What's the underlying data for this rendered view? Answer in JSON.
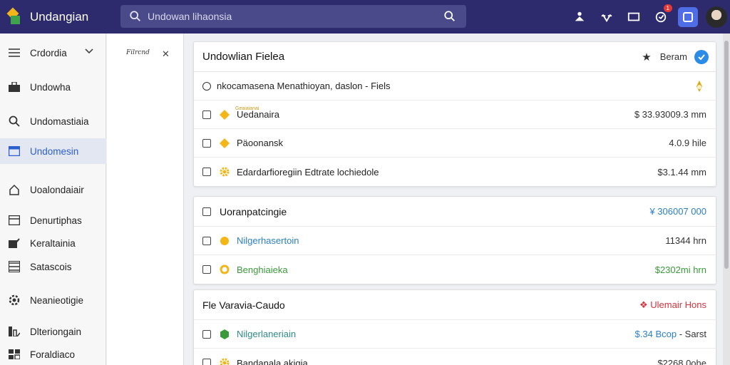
{
  "app": {
    "name": "Undangian"
  },
  "search": {
    "placeholder": "Undowan lihaonsia"
  },
  "topbar": {
    "notification_count": "1"
  },
  "sidebar": {
    "items": [
      {
        "label": "Crdordia",
        "icon": "menu-icon"
      },
      {
        "label": "Undowha",
        "icon": "briefcase-icon"
      },
      {
        "label": "Undomastiaia",
        "icon": "search-icon"
      },
      {
        "label": "Undomesin",
        "icon": "window-icon",
        "active": true
      },
      {
        "label": "Uoalondaiair",
        "icon": "home-icon"
      },
      {
        "label": "Denurtiphas",
        "icon": "window-icon"
      },
      {
        "label": "Keraltainia",
        "icon": "edit-icon"
      },
      {
        "label": "Satascois",
        "icon": "list-icon"
      },
      {
        "label": "Neanieotigie",
        "icon": "gear-icon"
      },
      {
        "label": "Dlteriongain",
        "icon": "chart-icon"
      },
      {
        "label": "Foraldiaco",
        "icon": "grid-icon"
      }
    ]
  },
  "subpanel": {
    "title": "Filrcnd"
  },
  "cards": [
    {
      "title": "Undowlian Fielea",
      "action_label": "Beram",
      "info_row": "nkocamasena Menathioyan, daslon - Fiels",
      "rows": [
        {
          "label": "Uedanaira",
          "sublabel": "Geaiaianai",
          "value": "$ 33.93009.3 mm"
        },
        {
          "label": "Päoonansk",
          "value": "4.0.9 hile"
        },
        {
          "label": "Edardarfioregiin Edtrate lochiedole",
          "value": "$3.1.44 mm"
        }
      ]
    },
    {
      "title": "Uoranpatcingie",
      "title_value": "¥ 306007 000",
      "rows": [
        {
          "label": "Nilgerhasertoin",
          "value": "11344 hrn"
        },
        {
          "label": "Benghiaieka",
          "value": "$2302mi hrn"
        }
      ]
    },
    {
      "title": "Fle Varavia-Caudo",
      "title_value": "Ulemair Hons",
      "rows": [
        {
          "label": "Nilgerlaneriain",
          "value": "$.34 Bcop",
          "value_suffix": "- Sarst"
        },
        {
          "label": "Bandanala akigia",
          "value": "$2268 0ohe"
        }
      ]
    }
  ],
  "colors": {
    "topbar": "#2d2a6e",
    "accent_blue": "#2b8ce8",
    "active_nav": "#2d5fcf",
    "link_blue": "#2b7fc7",
    "money_green": "#3a9a3a",
    "alert_red": "#d8343d",
    "star_yellow": "#f2b619",
    "teal": "#2e8a8a"
  }
}
